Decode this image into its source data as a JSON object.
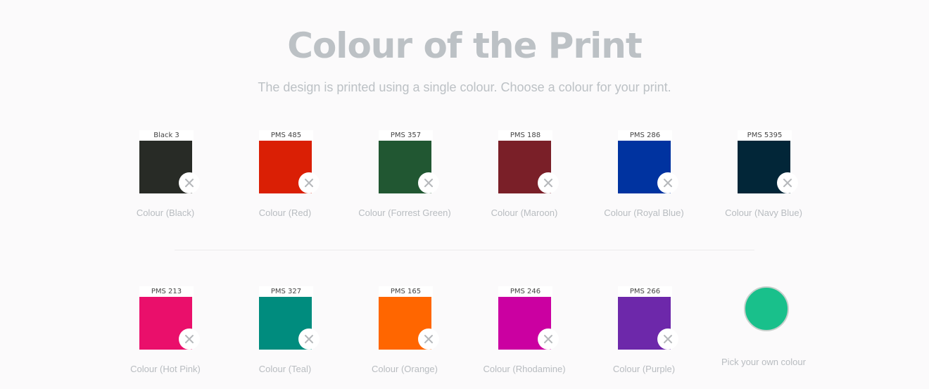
{
  "header": {
    "title": "Colour of the Print",
    "subtitle": "The design is printed using a single colour. Choose a colour for your print."
  },
  "swatches_row1": [
    {
      "code": "Black 3",
      "label": "Colour (Black)",
      "color": "#282b26"
    },
    {
      "code": "PMS 485",
      "label": "Colour (Red)",
      "color": "#da1f05"
    },
    {
      "code": "PMS 357",
      "label": "Colour (Forrest Green)",
      "color": "#215732"
    },
    {
      "code": "PMS 188",
      "label": "Colour (Maroon)",
      "color": "#7a1f28"
    },
    {
      "code": "PMS 286",
      "label": "Colour (Royal Blue)",
      "color": "#0033a0"
    },
    {
      "code": "PMS 5395",
      "label": "Colour (Navy Blue)",
      "color": "#022638"
    }
  ],
  "swatches_row2": [
    {
      "code": "PMS 213",
      "label": "Colour (Hot Pink)",
      "color": "#ea0f6b"
    },
    {
      "code": "PMS 327",
      "label": "Colour (Teal)",
      "color": "#008c7e"
    },
    {
      "code": "PMS 165",
      "label": "Colour (Orange)",
      "color": "#ff6600"
    },
    {
      "code": "PMS 246",
      "label": "Colour (Rhodamine)",
      "color": "#cb00a1"
    },
    {
      "code": "PMS 266",
      "label": "Colour (Purple)",
      "color": "#6d28aa"
    }
  ],
  "custom_colour": {
    "label": "Pick your own colour",
    "color": "#19c08b"
  },
  "icons": {
    "remove": "close-icon"
  }
}
